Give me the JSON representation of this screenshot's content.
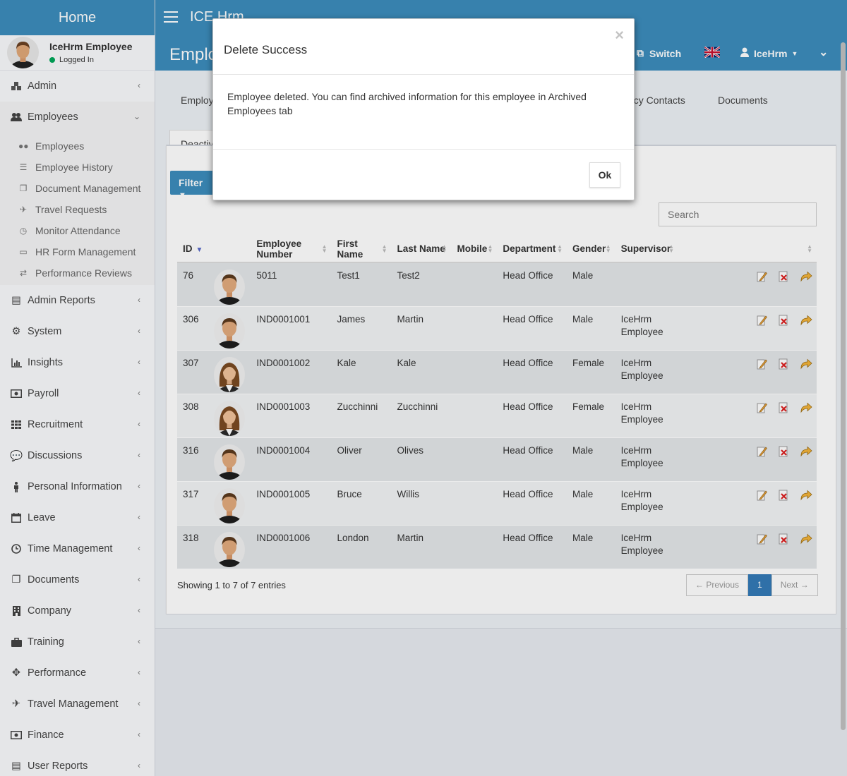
{
  "sidebar": {
    "logo": "Home",
    "user": {
      "name": "IceHrm Employee",
      "status": "Logged In"
    },
    "items": [
      {
        "label": "Admin",
        "icon": "cubes-icon"
      },
      {
        "label": "Employees",
        "icon": "users-icon"
      },
      {
        "label": "Admin Reports",
        "icon": "file-icon"
      },
      {
        "label": "System",
        "icon": "cogs-icon"
      },
      {
        "label": "Insights",
        "icon": "bar-chart-icon"
      },
      {
        "label": "Payroll",
        "icon": "money-icon"
      },
      {
        "label": "Recruitment",
        "icon": "grid-icon"
      },
      {
        "label": "Discussions",
        "icon": "comments-icon"
      },
      {
        "label": "Personal Information",
        "icon": "person-icon"
      },
      {
        "label": "Leave",
        "icon": "calendar-icon"
      },
      {
        "label": "Time Management",
        "icon": "clock-icon"
      },
      {
        "label": "Documents",
        "icon": "files-icon"
      },
      {
        "label": "Company",
        "icon": "building-icon"
      },
      {
        "label": "Training",
        "icon": "briefcase-icon"
      },
      {
        "label": "Performance",
        "icon": "crosshair-icon"
      },
      {
        "label": "Travel Management",
        "icon": "plane-icon"
      },
      {
        "label": "Finance",
        "icon": "money-icon"
      },
      {
        "label": "User Reports",
        "icon": "file-icon"
      }
    ],
    "employees_submenu": [
      {
        "label": "Employees",
        "icon": "users-icon"
      },
      {
        "label": "Employee History",
        "icon": "list-icon"
      },
      {
        "label": "Document Management",
        "icon": "files-icon"
      },
      {
        "label": "Travel Requests",
        "icon": "plane-icon"
      },
      {
        "label": "Monitor Attendance",
        "icon": "clock-icon"
      },
      {
        "label": "HR Form Management",
        "icon": "folder-icon"
      },
      {
        "label": "Performance Reviews",
        "icon": "exchange-icon"
      }
    ]
  },
  "topbar": {
    "brand": "ICE Hrm",
    "page_title": "Emplo",
    "switch_label": "Switch",
    "user_menu": "IceHrm"
  },
  "tabs": {
    "first": "Employ",
    "contacts": "ncy Contacts",
    "documents": "Documents",
    "active": "Deactiv"
  },
  "toolbar": {
    "filter_label": "Filter",
    "search_placeholder": "Search"
  },
  "table": {
    "columns": [
      "ID",
      "",
      "Employee Number",
      "First Name",
      "Last Name",
      "Mobile",
      "Department",
      "Gender",
      "Supervisor",
      ""
    ],
    "rows": [
      {
        "id": "76",
        "gender_avatar": "male",
        "number": "5011",
        "first": "Test1",
        "last": "Test2",
        "mobile": "",
        "dept": "Head Office",
        "gender": "Male",
        "sup1": "",
        "sup2": ""
      },
      {
        "id": "306",
        "gender_avatar": "male",
        "number": "IND0001001",
        "first": "James",
        "last": "Martin",
        "mobile": "",
        "dept": "Head Office",
        "gender": "Male",
        "sup1": "IceHrm",
        "sup2": "Employee"
      },
      {
        "id": "307",
        "gender_avatar": "female",
        "number": "IND0001002",
        "first": "Kale",
        "last": "Kale",
        "mobile": "",
        "dept": "Head Office",
        "gender": "Female",
        "sup1": "IceHrm",
        "sup2": "Employee"
      },
      {
        "id": "308",
        "gender_avatar": "female",
        "number": "IND0001003",
        "first": "Zucchinni",
        "last": "Zucchinni",
        "mobile": "",
        "dept": "Head Office",
        "gender": "Female",
        "sup1": "IceHrm",
        "sup2": "Employee"
      },
      {
        "id": "316",
        "gender_avatar": "male",
        "number": "IND0001004",
        "first": "Oliver",
        "last": "Olives",
        "mobile": "",
        "dept": "Head Office",
        "gender": "Male",
        "sup1": "IceHrm",
        "sup2": "Employee"
      },
      {
        "id": "317",
        "gender_avatar": "male",
        "number": "IND0001005",
        "first": "Bruce",
        "last": "Willis",
        "mobile": "",
        "dept": "Head Office",
        "gender": "Male",
        "sup1": "IceHrm",
        "sup2": "Employee"
      },
      {
        "id": "318",
        "gender_avatar": "male",
        "number": "IND0001006",
        "first": "London",
        "last": "Martin",
        "mobile": "",
        "dept": "Head Office",
        "gender": "Male",
        "sup1": "IceHrm",
        "sup2": "Employee"
      }
    ]
  },
  "footer": {
    "showing": "Showing 1 to 7 of 7 entries",
    "prev": "← Previous",
    "page": "1",
    "next": "Next →"
  },
  "modal": {
    "title": "Delete Success",
    "close": "×",
    "body": "Employee deleted. You can find archived information for this employee in Archived Employees tab",
    "ok": "Ok"
  },
  "colors": {
    "brand": "#3c8dbc",
    "page_active": "#337ab7",
    "status_online": "#00a65a"
  }
}
